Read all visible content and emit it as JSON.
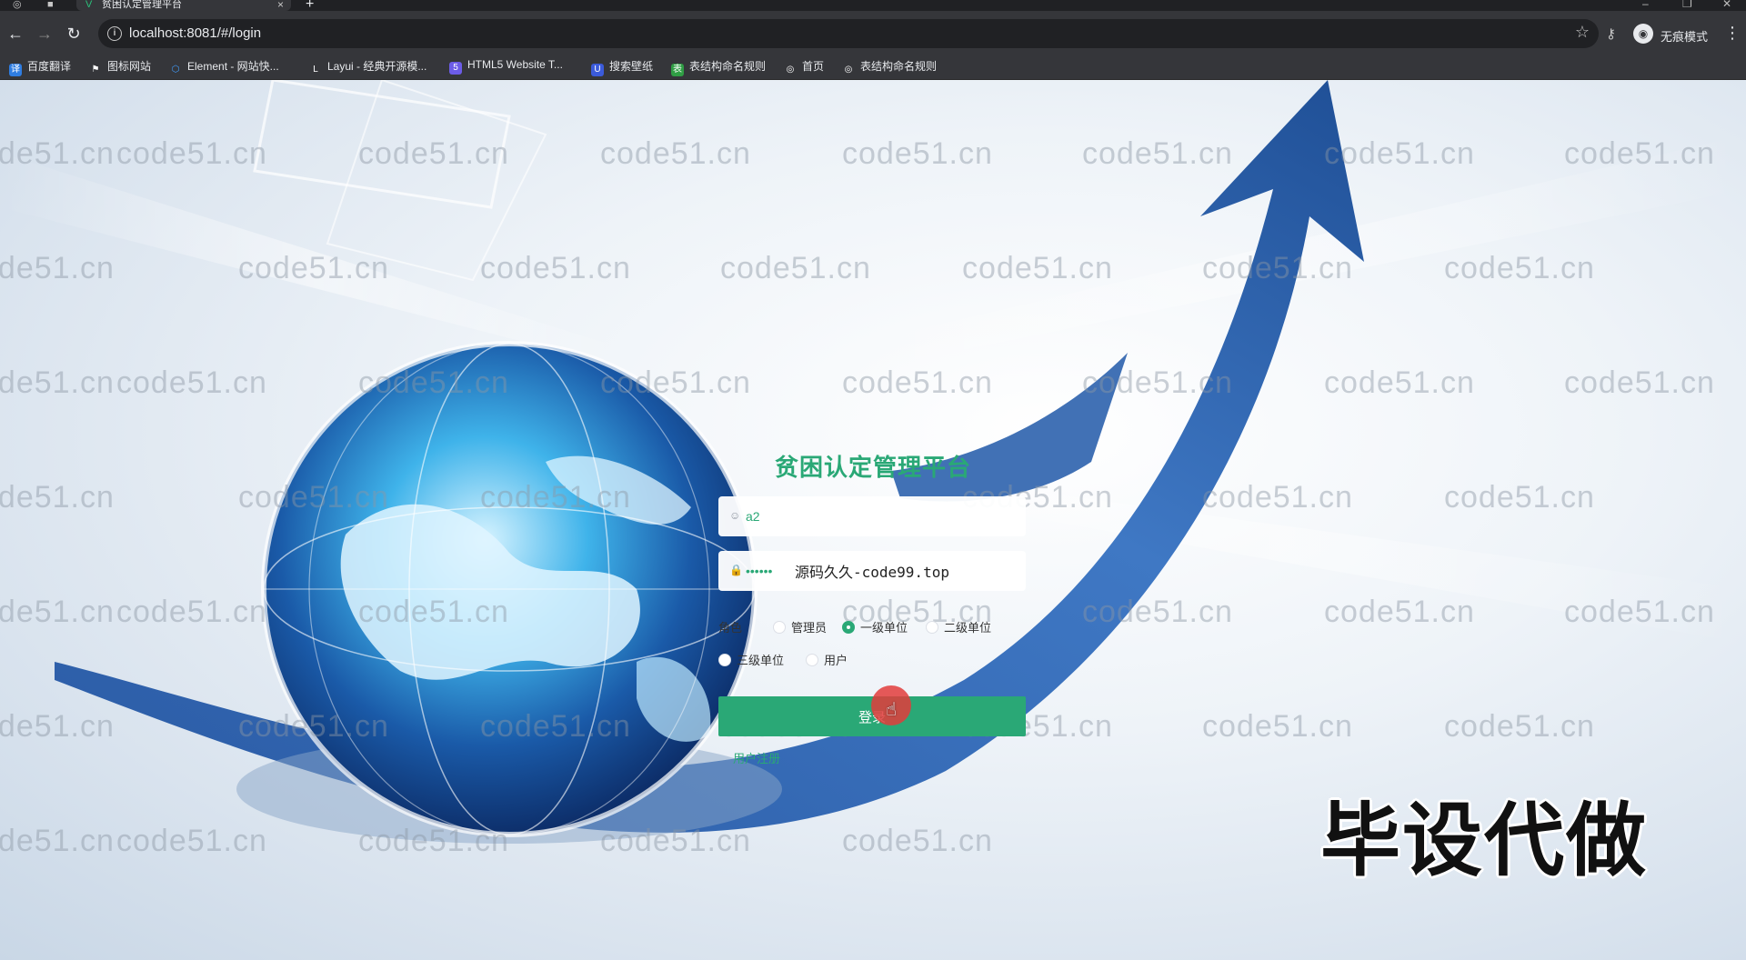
{
  "browser": {
    "tab_title": "贫困认定管理平台",
    "url": "localhost:8081/#/login",
    "incognito_label": "无痕模式",
    "bookmarks": [
      {
        "label": "百度翻译",
        "color": "#2f7de1",
        "glyph": "译"
      },
      {
        "label": "图标网站",
        "color": "#444444",
        "glyph": "⚑"
      },
      {
        "label": "Element - 网站快...",
        "color": "#409eff",
        "glyph": "⬡"
      },
      {
        "label": "Layui - 经典开源模...",
        "color": "#555555",
        "glyph": "L"
      },
      {
        "label": "HTML5 Website T...",
        "color": "#6c5ce7",
        "glyph": "5"
      },
      {
        "label": "搜索壁纸",
        "color": "#3b5bdb",
        "glyph": "U"
      },
      {
        "label": "表结构命名规则",
        "color": "#2f9e44",
        "glyph": "表"
      },
      {
        "label": "首页",
        "color": "#444444",
        "glyph": "◎"
      },
      {
        "label": "表结构命名规则",
        "color": "#444444",
        "glyph": "◎"
      }
    ]
  },
  "login": {
    "title": "贫困认定管理平台",
    "username_value": "a2",
    "password_mask": "••••••",
    "password_overlay": "源码久久-code99.top",
    "role_label": "角色",
    "roles": [
      {
        "label": "管理员",
        "selected": false
      },
      {
        "label": "一级单位",
        "selected": true
      },
      {
        "label": "二级单位",
        "selected": false
      },
      {
        "label": "三级单位",
        "selected": false
      },
      {
        "label": "用户",
        "selected": false
      }
    ],
    "login_button": "登录",
    "register_link": "用户注册"
  },
  "watermark_text": "code51.cn",
  "promo_text": "毕设代做",
  "colors": {
    "accent": "#2aa876",
    "chrome_dark": "#35363a"
  }
}
